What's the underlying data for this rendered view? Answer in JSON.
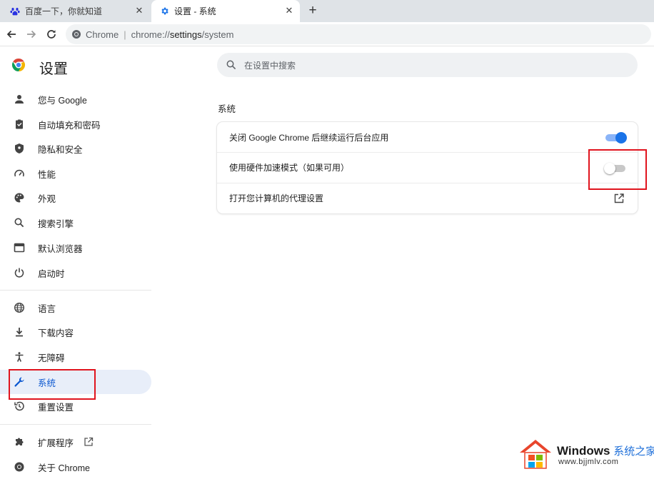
{
  "tabs": [
    {
      "title": "百度一下，你就知道",
      "icon": "baidu-paw-icon",
      "active": false
    },
    {
      "title": "设置 - 系统",
      "icon": "settings-gear-icon",
      "active": true
    }
  ],
  "toolbar": {
    "site_name": "Chrome",
    "url_scheme": "chrome://",
    "url_host": "settings",
    "url_path": "/system"
  },
  "settings_title": "设置",
  "sidebar": {
    "items": [
      {
        "label": "您与 Google",
        "icon": "person-icon"
      },
      {
        "label": "自动填充和密码",
        "icon": "clipboard-icon"
      },
      {
        "label": "隐私和安全",
        "icon": "shield-icon"
      },
      {
        "label": "性能",
        "icon": "speedometer-icon"
      },
      {
        "label": "外观",
        "icon": "palette-icon"
      },
      {
        "label": "搜索引擎",
        "icon": "search-icon"
      },
      {
        "label": "默认浏览器",
        "icon": "browser-window-icon"
      },
      {
        "label": "启动时",
        "icon": "power-icon"
      },
      {
        "label": "语言",
        "icon": "globe-icon"
      },
      {
        "label": "下载内容",
        "icon": "download-icon"
      },
      {
        "label": "无障碍",
        "icon": "accessibility-icon"
      },
      {
        "label": "系统",
        "icon": "wrench-icon",
        "selected": true
      },
      {
        "label": "重置设置",
        "icon": "history-icon"
      },
      {
        "label": "扩展程序",
        "icon": "puzzle-icon"
      },
      {
        "label": "关于 Chrome",
        "icon": "chrome-logo-icon"
      }
    ]
  },
  "search": {
    "placeholder": "在设置中搜索"
  },
  "section_title": "系统",
  "system_rows": [
    {
      "label": "关闭 Google Chrome 后继续运行后台应用",
      "control": "toggle",
      "checked": true
    },
    {
      "label": "使用硬件加速模式（如果可用）",
      "control": "toggle",
      "checked": false
    },
    {
      "label": "打开您计算机的代理设置",
      "control": "external-link"
    }
  ],
  "watermark": {
    "brand": "Windows",
    "brand_suffix": "系统之家",
    "url": "www.bjjmlv.com"
  },
  "colors": {
    "accent": "#1a73e8",
    "selected_bg": "#e8eef9",
    "highlight": "#e0141e"
  }
}
